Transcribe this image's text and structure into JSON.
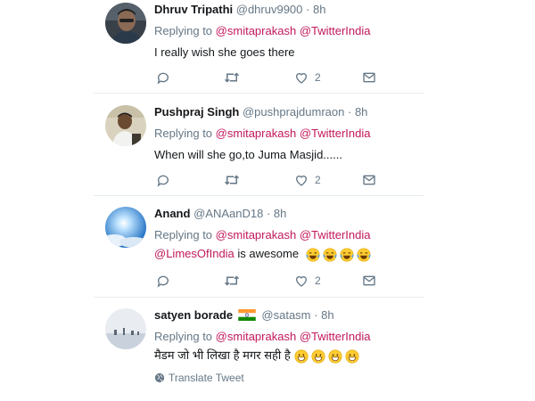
{
  "tweets": [
    {
      "name": "Dhruv Tripathi",
      "handle": "@dhruv9900",
      "time": "8h",
      "replying_label": "Replying to",
      "mentions": [
        "@smitaprakash",
        "@TwitterIndia"
      ],
      "text": "I really wish she goes there",
      "like_count": "2"
    },
    {
      "name": "Pushpraj Singh",
      "handle": "@pushprajdumraon",
      "time": "8h",
      "replying_label": "Replying to",
      "mentions": [
        "@smitaprakash",
        "@TwitterIndia"
      ],
      "text": "When will she go,to Juma Masjid......",
      "like_count": "2"
    },
    {
      "name": "Anand",
      "handle": "@ANAanD18",
      "time": "8h",
      "replying_label": "Replying to",
      "mentions": [
        "@smitaprakash",
        "@TwitterIndia"
      ],
      "text_mention": "@LimesOfIndia",
      "text": "is awesome",
      "like_count": "2"
    },
    {
      "name": "satyen borade",
      "handle": "@satasm",
      "time": "8h",
      "replying_label": "Replying to",
      "mentions": [
        "@smitaprakash",
        "@TwitterIndia"
      ],
      "text": "मैडम जो भी लिखा है मगर सही है",
      "translate_label": "Translate Tweet"
    }
  ],
  "separator": "·",
  "icons": {
    "reply": "reply-icon",
    "retweet": "retweet-icon",
    "like": "heart-icon",
    "dm": "envelope-icon",
    "laugh_emoji": "tears-of-joy-emoji",
    "grin_emoji": "grinning-emoji",
    "flag": "india-flag-icon",
    "globe": "globe-icon"
  },
  "colors": {
    "mention": "#c2185b",
    "muted": "#657786",
    "text": "#14171a",
    "divider": "#e6ecf0"
  }
}
